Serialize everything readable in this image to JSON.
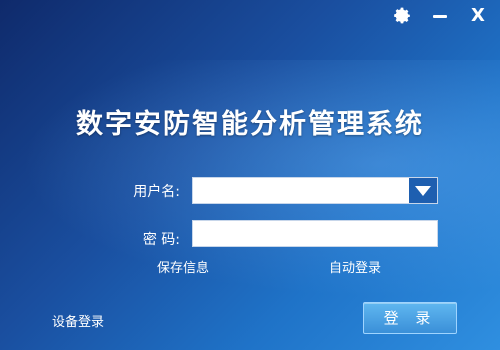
{
  "title": "数字安防智能分析管理系统",
  "window_controls": {
    "settings_icon": "gear-icon",
    "minimize_icon": "minimize-icon",
    "close_label": "X"
  },
  "form": {
    "username_label": "用户名:",
    "username_value": "",
    "password_label": "密 码:",
    "password_value": ""
  },
  "options": {
    "save_info": "保存信息",
    "auto_login": "自动登录"
  },
  "device_login": "设备登录",
  "login_button": "登 录",
  "colors": {
    "background_top": "#0f2a6b",
    "background_bottom": "#2f8fe0",
    "button": "#3a8fd8",
    "dropdown_button": "#1e5fb0"
  }
}
